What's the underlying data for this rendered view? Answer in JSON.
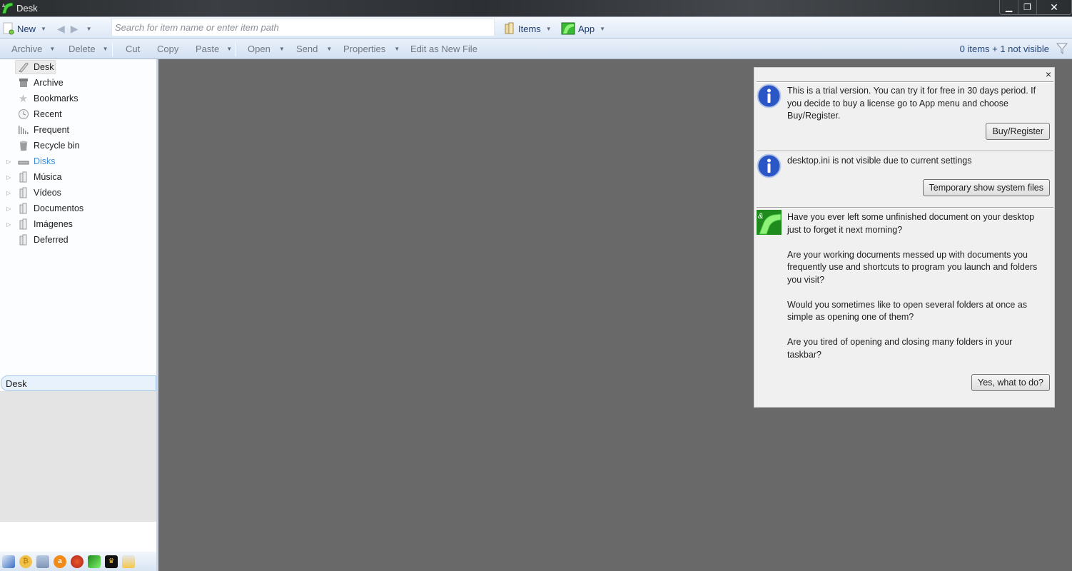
{
  "window": {
    "title": "Desk",
    "controls": {
      "minimize": "▁",
      "restore": "❐",
      "close": "✕"
    }
  },
  "toolbar1": {
    "new_label": "New",
    "search_placeholder": "Search for item name or enter item path",
    "search_value": "",
    "items_label": "Items",
    "app_label": "App"
  },
  "toolbar2": {
    "buttons": [
      {
        "label": "Archive",
        "dropdown": true
      },
      {
        "label": "Delete",
        "dropdown": true
      },
      {
        "label": "Cut",
        "dropdown": false
      },
      {
        "label": "Copy",
        "dropdown": false
      },
      {
        "label": "Paste",
        "dropdown": true
      },
      {
        "label": "Open",
        "dropdown": true
      },
      {
        "label": "Send",
        "dropdown": true
      },
      {
        "label": "Properties",
        "dropdown": true
      },
      {
        "label": "Edit as New File",
        "dropdown": false
      }
    ],
    "status": "0 items + 1 not visible"
  },
  "sidebar": {
    "items": [
      {
        "label": "Desk",
        "icon": "desk-icon",
        "selected": true,
        "expandable": false
      },
      {
        "label": "Archive",
        "icon": "archive-icon",
        "expandable": false
      },
      {
        "label": "Bookmarks",
        "icon": "star-icon",
        "expandable": false
      },
      {
        "label": "Recent",
        "icon": "clock-icon",
        "expandable": false
      },
      {
        "label": "Frequent",
        "icon": "bars-icon",
        "expandable": false
      },
      {
        "label": "Recycle bin",
        "icon": "recycle-bin-icon",
        "expandable": false
      },
      {
        "label": "Disks",
        "icon": "disk-icon",
        "expandable": true,
        "link": true
      },
      {
        "label": "Música",
        "icon": "library-icon",
        "expandable": true
      },
      {
        "label": "Vídeos",
        "icon": "library-icon",
        "expandable": true
      },
      {
        "label": "Documentos",
        "icon": "library-icon",
        "expandable": true
      },
      {
        "label": "Imágenes",
        "icon": "library-icon",
        "expandable": true
      },
      {
        "label": "Deferred",
        "icon": "library-icon",
        "expandable": false
      }
    ],
    "location_value": "Desk",
    "quickbar": [
      "pen-icon",
      "bitcoin-icon",
      "network-icon",
      "avast-icon",
      "ccleaner-icon",
      "desk-app-icon",
      "shopping-bag-icon",
      "keys-icon"
    ]
  },
  "notifications": {
    "close": "×",
    "trial": {
      "text": "This is a trial version. You can try it for free in 30 days period. If you decide to buy a license go to App menu and choose Buy/Register.",
      "button": "Buy/Register"
    },
    "hidden_file": {
      "text": "desktop.ini is not visible due to current settings",
      "button": "Temporary show system files"
    },
    "promo": {
      "paragraphs": [
        "Have you ever left some unfinished document on your desktop just to forget it next morning?",
        "Are your working documents messed up with documents you frequently use and shortcuts to program you launch and folders you visit?",
        "Would you sometimes like to open several folders at once as simple as opening one of them?",
        "Are you tired of opening and closing many folders in your taskbar?"
      ],
      "button": "Yes, what to do?"
    }
  },
  "colors": {
    "content_bg": "#696969",
    "toolbar_text": "#1e3b6e",
    "link_blue": "#3f8fd6",
    "app_green": "#3fc63a"
  }
}
